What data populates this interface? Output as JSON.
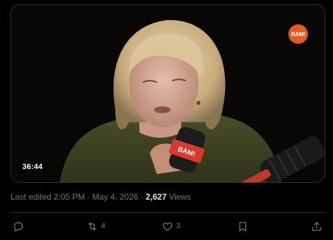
{
  "video": {
    "duration": "36:44",
    "logo_text": "BAM!",
    "mic_label": "BAM!"
  },
  "meta": {
    "edited_text": "Last edited 2:05 PM · May 4, 2026 · ",
    "views_count": "2,627",
    "views_label": " Views"
  },
  "actions": {
    "reply_icon": "reply-icon",
    "repost_icon": "repost-icon",
    "repost_count": "4",
    "like_icon": "heart-icon",
    "like_count": "3",
    "bookmark_icon": "bookmark-icon",
    "share_icon": "share-icon"
  },
  "colors": {
    "background": "#000000",
    "muted_text": "#71767b",
    "primary_text": "#e7e9ea",
    "divider": "#2f3336",
    "logo_orange": "#e35a26"
  }
}
